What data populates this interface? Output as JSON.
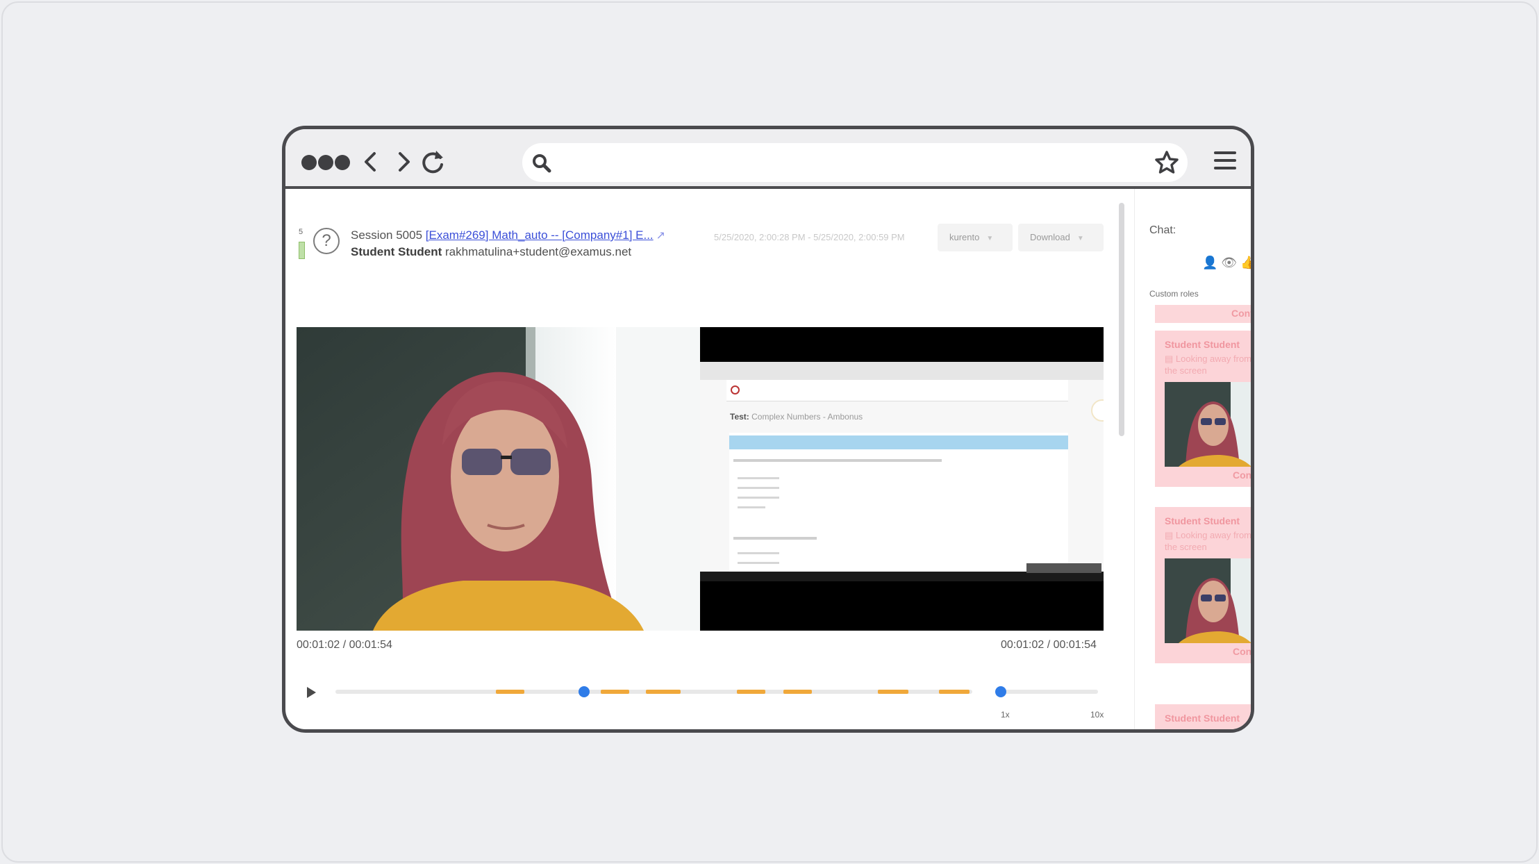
{
  "session": {
    "row_number": "5",
    "prefix": "Session 5005",
    "exam_link": "[Exam#269] Math_auto -- [Company#1] E...",
    "student_name": "Student Student",
    "student_email": "rakhmatulina+student@examus.net",
    "time_range": "5/25/2020, 2:00:28 PM - 5/25/2020, 2:00:59 PM",
    "server_select": "kurento",
    "download_label": "Download"
  },
  "player": {
    "time_left": "00:01:02 / 00:01:54",
    "time_right": "00:01:02 / 00:01:54",
    "progress": 0.39,
    "speed_min_label": "1x",
    "speed_max_label": "10x",
    "speed_value": "1x"
  },
  "screen_share": {
    "test_label": "Test:",
    "test_title": "Complex Numbers - Ambonus"
  },
  "chat": {
    "title": "Chat:",
    "custom_roles_label": "Custom roles",
    "confirm_label": "Confi",
    "alerts": [
      {
        "name": "Student Student",
        "message": "Looking away from the screen",
        "confirm": "Confi"
      },
      {
        "name": "Student Student",
        "message": "Looking away from the screen",
        "confirm": "Confi"
      },
      {
        "name": "Student Student"
      }
    ]
  },
  "icons": [
    "menu-dots-icon",
    "back-arrow-icon",
    "forward-arrow-icon",
    "reload-icon",
    "search-icon",
    "star-icon",
    "hamburger-menu-icon",
    "help-icon",
    "external-link-icon",
    "play-icon",
    "user-icon",
    "eye-off-icon",
    "thumbs-up-icon"
  ],
  "colors": {
    "link": "#3b4fd8",
    "timeline_marker": "#f0a83a",
    "knob": "#2f7ce8",
    "alert_bg": "#fcd4d8",
    "alert_text": "#f0969f"
  }
}
